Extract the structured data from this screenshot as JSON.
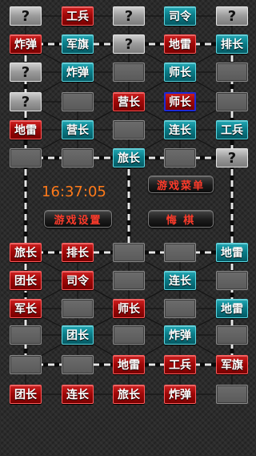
{
  "clock": "16:37:05",
  "menu": {
    "game_menu": "游戏菜单",
    "game_settings": "游戏设置",
    "regret": "悔  棋"
  },
  "colors": {
    "enemy": "#a00808",
    "player": "#0b7d89",
    "unknown": "#9a9a9a",
    "selected_outline": "#1e2bd6",
    "clock": "#ff7a1a"
  },
  "board": {
    "top": [
      [
        {
          "t": "grey",
          "l": "?"
        },
        {
          "t": "red",
          "l": "工兵"
        },
        {
          "t": "grey",
          "l": "?"
        },
        {
          "t": "teal",
          "l": "司令"
        },
        {
          "t": "grey",
          "l": "?"
        }
      ],
      [
        {
          "t": "red",
          "l": "炸弹"
        },
        {
          "t": "teal",
          "l": "军旗"
        },
        {
          "t": "grey",
          "l": "?"
        },
        {
          "t": "red",
          "l": "地雷"
        },
        {
          "t": "teal",
          "l": "排长"
        }
      ],
      [
        {
          "t": "grey",
          "l": "?"
        },
        {
          "t": "teal",
          "l": "炸弹"
        },
        {
          "t": "slot",
          "l": ""
        },
        {
          "t": "teal",
          "l": "师长"
        },
        {
          "t": "slot",
          "l": ""
        }
      ],
      [
        {
          "t": "grey",
          "l": "?"
        },
        {
          "t": "slot",
          "l": ""
        },
        {
          "t": "red",
          "l": "营长"
        },
        {
          "t": "red",
          "l": "师长",
          "selected": true
        },
        {
          "t": "slot",
          "l": ""
        }
      ],
      [
        {
          "t": "red",
          "l": "地雷"
        },
        {
          "t": "teal",
          "l": "营长"
        },
        {
          "t": "slot",
          "l": ""
        },
        {
          "t": "teal",
          "l": "连长"
        },
        {
          "t": "teal",
          "l": "工兵"
        }
      ],
      [
        {
          "t": "slot",
          "l": ""
        },
        {
          "t": "slot",
          "l": ""
        },
        {
          "t": "teal",
          "l": "旅长"
        },
        {
          "t": "slot",
          "l": ""
        },
        {
          "t": "grey",
          "l": "?"
        }
      ]
    ],
    "bottom": [
      [
        {
          "t": "red",
          "l": "旅长"
        },
        {
          "t": "red",
          "l": "排长"
        },
        {
          "t": "slot",
          "l": ""
        },
        {
          "t": "slot",
          "l": ""
        },
        {
          "t": "teal",
          "l": "地雷"
        }
      ],
      [
        {
          "t": "red",
          "l": "团长"
        },
        {
          "t": "red",
          "l": "司令"
        },
        {
          "t": "slot",
          "l": ""
        },
        {
          "t": "teal",
          "l": "连长"
        },
        {
          "t": "slot",
          "l": ""
        }
      ],
      [
        {
          "t": "red",
          "l": "军长"
        },
        {
          "t": "slot",
          "l": ""
        },
        {
          "t": "red",
          "l": "师长"
        },
        {
          "t": "slot",
          "l": ""
        },
        {
          "t": "teal",
          "l": "地雷"
        }
      ],
      [
        {
          "t": "slot",
          "l": ""
        },
        {
          "t": "teal",
          "l": "团长"
        },
        {
          "t": "slot",
          "l": ""
        },
        {
          "t": "teal",
          "l": "炸弹"
        },
        {
          "t": "slot",
          "l": ""
        }
      ],
      [
        {
          "t": "slot",
          "l": ""
        },
        {
          "t": "slot",
          "l": ""
        },
        {
          "t": "red",
          "l": "地雷"
        },
        {
          "t": "red",
          "l": "工兵"
        },
        {
          "t": "red",
          "l": "军旗"
        }
      ],
      [
        {
          "t": "red",
          "l": "团长"
        },
        {
          "t": "red",
          "l": "连长"
        },
        {
          "t": "red",
          "l": "旅长"
        },
        {
          "t": "red",
          "l": "炸弹"
        },
        {
          "t": "slot",
          "l": ""
        }
      ]
    ]
  }
}
